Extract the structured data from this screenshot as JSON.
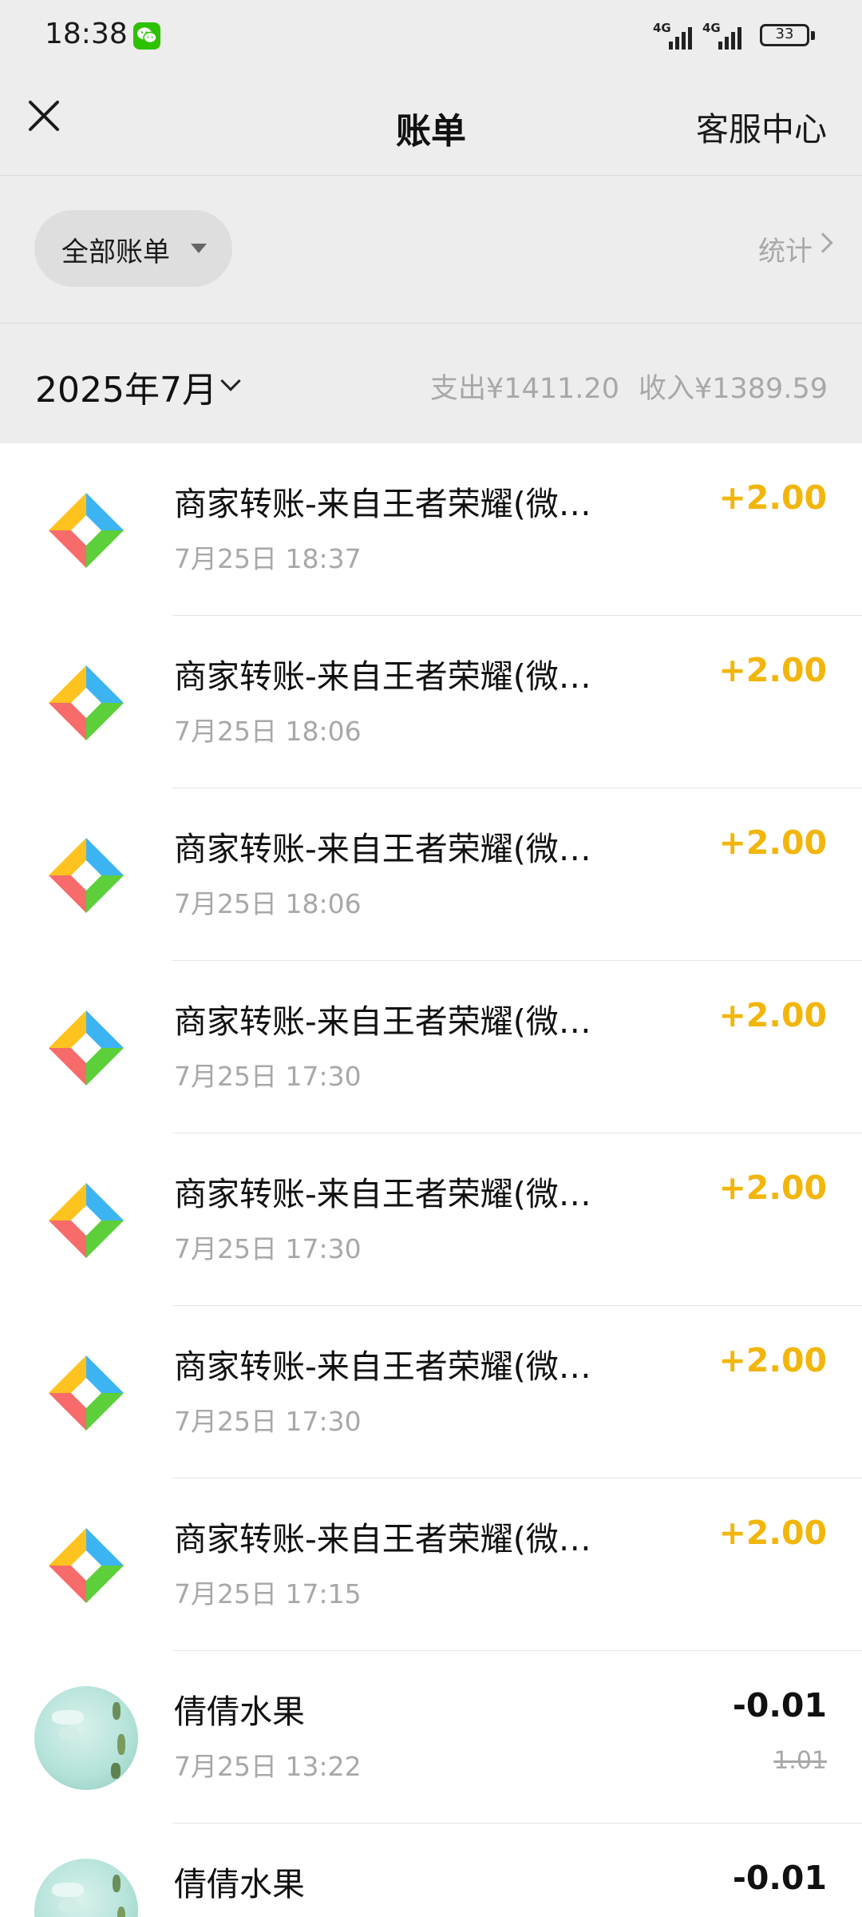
{
  "status_bar": {
    "time": "18:38",
    "network_1": "4G",
    "network_2": "4G",
    "battery": "33",
    "notification_icon": "wechat-icon"
  },
  "header": {
    "title": "账单",
    "close_icon": "close-icon",
    "service_label": "客服中心"
  },
  "filter": {
    "label": "全部账单",
    "stats_label": "统计"
  },
  "month": {
    "label": "2025年7月",
    "expense": "支出¥1411.20",
    "income": "收入¥1389.59"
  },
  "colors": {
    "income_amount": "#f2b50a",
    "logo_yellow": "#ffc31f",
    "logo_blue": "#3db4f2",
    "logo_red": "#f76b6b",
    "logo_green": "#5ccf3a"
  },
  "transactions": [
    {
      "title": "商家转账-来自王者荣耀(微…",
      "time": "7月25日 18:37",
      "amount": "+2.00",
      "type": "income",
      "icon": "merchant-transfer-logo-icon"
    },
    {
      "title": "商家转账-来自王者荣耀(微…",
      "time": "7月25日 18:06",
      "amount": "+2.00",
      "type": "income",
      "icon": "merchant-transfer-logo-icon"
    },
    {
      "title": "商家转账-来自王者荣耀(微…",
      "time": "7月25日 18:06",
      "amount": "+2.00",
      "type": "income",
      "icon": "merchant-transfer-logo-icon"
    },
    {
      "title": "商家转账-来自王者荣耀(微…",
      "time": "7月25日 17:30",
      "amount": "+2.00",
      "type": "income",
      "icon": "merchant-transfer-logo-icon"
    },
    {
      "title": "商家转账-来自王者荣耀(微…",
      "time": "7月25日 17:30",
      "amount": "+2.00",
      "type": "income",
      "icon": "merchant-transfer-logo-icon"
    },
    {
      "title": "商家转账-来自王者荣耀(微…",
      "time": "7月25日 17:30",
      "amount": "+2.00",
      "type": "income",
      "icon": "merchant-transfer-logo-icon"
    },
    {
      "title": "商家转账-来自王者荣耀(微…",
      "time": "7月25日 17:15",
      "amount": "+2.00",
      "type": "income",
      "icon": "merchant-transfer-logo-icon"
    },
    {
      "title": "倩倩水果",
      "time": "7月25日 13:22",
      "amount": "-0.01",
      "original_amount": "1.01",
      "type": "expense",
      "icon": "merchant-avatar"
    },
    {
      "title": "倩倩水果",
      "time": "",
      "amount": "-0.01",
      "type": "expense",
      "icon": "merchant-avatar"
    }
  ]
}
